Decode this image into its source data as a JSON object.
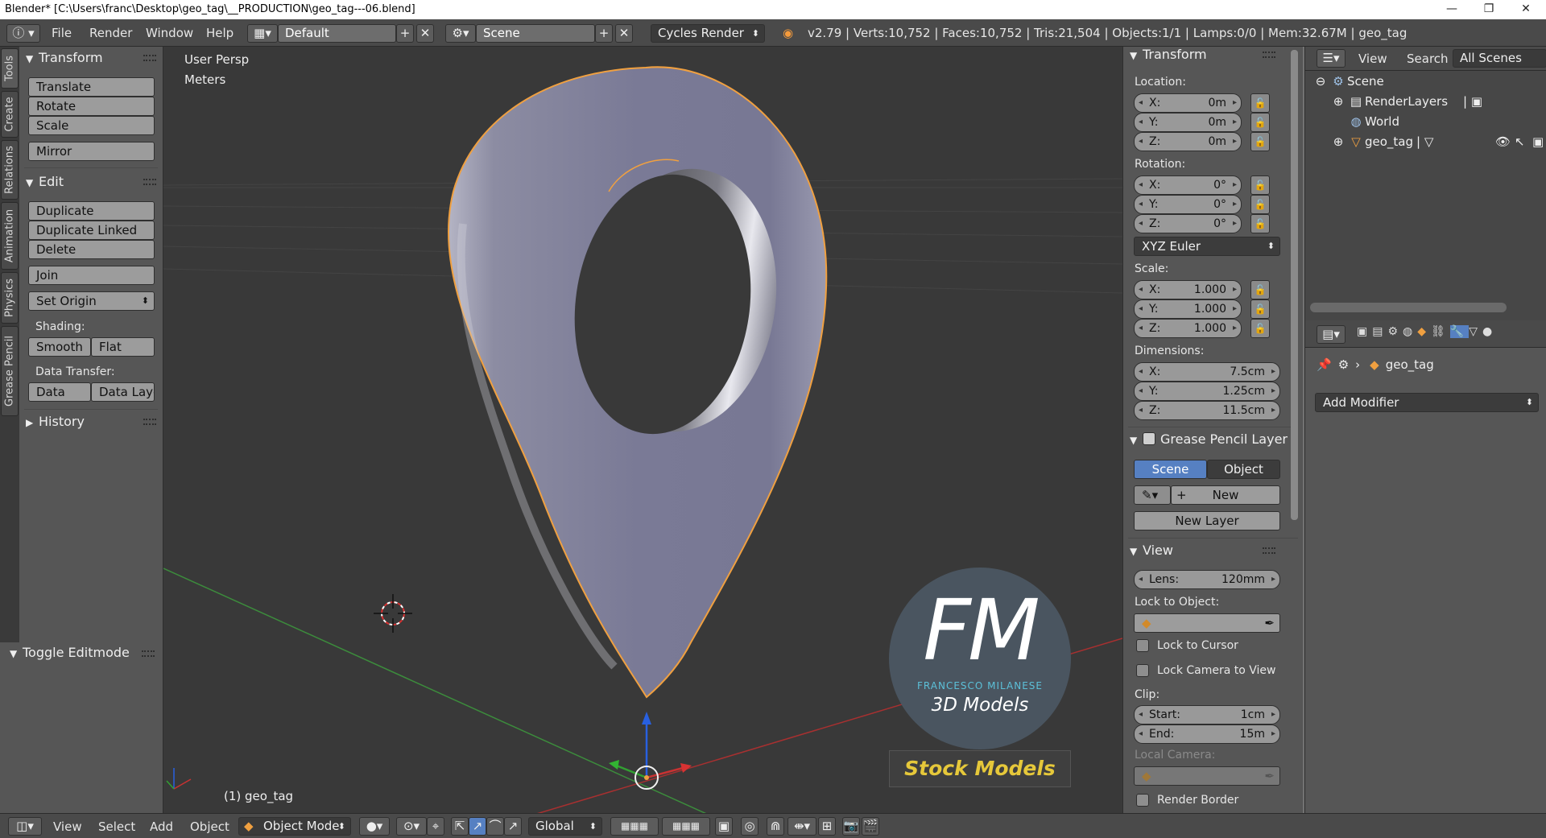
{
  "window": {
    "title": "Blender* [C:\\Users\\franc\\Desktop\\geo_tag\\__PRODUCTION\\geo_tag---06.blend]",
    "controls": {
      "minimize": "—",
      "maximize": "❐",
      "close": "✕"
    }
  },
  "info_header": {
    "menus": [
      "File",
      "Render",
      "Window",
      "Help"
    ],
    "screen_layout": "Default",
    "scene": "Scene",
    "render_engine": "Cycles Render",
    "stats": "v2.79 | Verts:10,752 | Faces:10,752 | Tris:21,504 | Objects:1/1 | Lamps:0/0 | Mem:32.67M | geo_tag"
  },
  "tool_tabs": [
    "Tools",
    "Create",
    "Relations",
    "Animation",
    "Physics",
    "Grease Pencil"
  ],
  "tool_shelf": {
    "transform": {
      "title": "Transform",
      "buttons": [
        "Translate",
        "Rotate",
        "Scale",
        "Mirror"
      ]
    },
    "edit": {
      "title": "Edit",
      "buttons": [
        "Duplicate",
        "Duplicate Linked",
        "Delete",
        "Join"
      ],
      "set_origin": "Set Origin",
      "shading_label": "Shading:",
      "smooth": "Smooth",
      "flat": "Flat",
      "data_transfer_label": "Data Transfer:",
      "data": "Data",
      "data_layout": "Data Layo"
    },
    "history": "History",
    "last_operator": "Toggle Editmode"
  },
  "viewport": {
    "view_name": "User Persp",
    "units": "Meters",
    "object_label": "(1) geo_tag",
    "watermark": {
      "logo": "FM",
      "author": "FRANCESCO MILANESE",
      "subtitle": "3D Models",
      "badge": "Stock Models"
    },
    "colors": {
      "background": "#393939",
      "selection_outline": "#f0a040",
      "x_axis": "#c83232",
      "y_axis": "#32a032",
      "z_axis": "#2860e0"
    }
  },
  "properties_region": {
    "transform_title": "Transform",
    "location_label": "Location:",
    "location": {
      "x": "0m",
      "y": "0m",
      "z": "0m"
    },
    "rotation_label": "Rotation:",
    "rotation": {
      "x": "0°",
      "y": "0°",
      "z": "0°"
    },
    "rotation_mode": "XYZ Euler",
    "scale_label": "Scale:",
    "scale": {
      "x": "1.000",
      "y": "1.000",
      "z": "1.000"
    },
    "dimensions_label": "Dimensions:",
    "dimensions": {
      "x": "7.5cm",
      "y": "1.25cm",
      "z": "11.5cm"
    },
    "axis": {
      "x": "X:",
      "y": "Y:",
      "z": "Z:"
    },
    "grease_pencil": {
      "title": "Grease Pencil Layer",
      "scene": "Scene",
      "object": "Object",
      "new": "New",
      "new_layer": "New Layer"
    },
    "view": {
      "title": "View",
      "lens_label": "Lens:",
      "lens": "120mm",
      "lock_to_object": "Lock to Object:",
      "lock_to_cursor": "Lock to Cursor",
      "lock_camera_to_view": "Lock Camera to View",
      "clip_label": "Clip:",
      "clip_start_label": "Start:",
      "clip_start": "1cm",
      "clip_end_label": "End:",
      "clip_end": "15m",
      "local_camera": "Local Camera:",
      "render_border": "Render Border"
    }
  },
  "outliner": {
    "menus": [
      "View",
      "Search"
    ],
    "display_mode": "All Scenes",
    "items": [
      "Scene",
      "RenderLayers",
      "World",
      "geo_tag"
    ]
  },
  "properties_editor": {
    "breadcrumb_object": "geo_tag",
    "add_modifier": "Add Modifier"
  },
  "view3d_header": {
    "menus": [
      "View",
      "Select",
      "Add",
      "Object"
    ],
    "mode": "Object Mode",
    "orientation": "Global"
  }
}
